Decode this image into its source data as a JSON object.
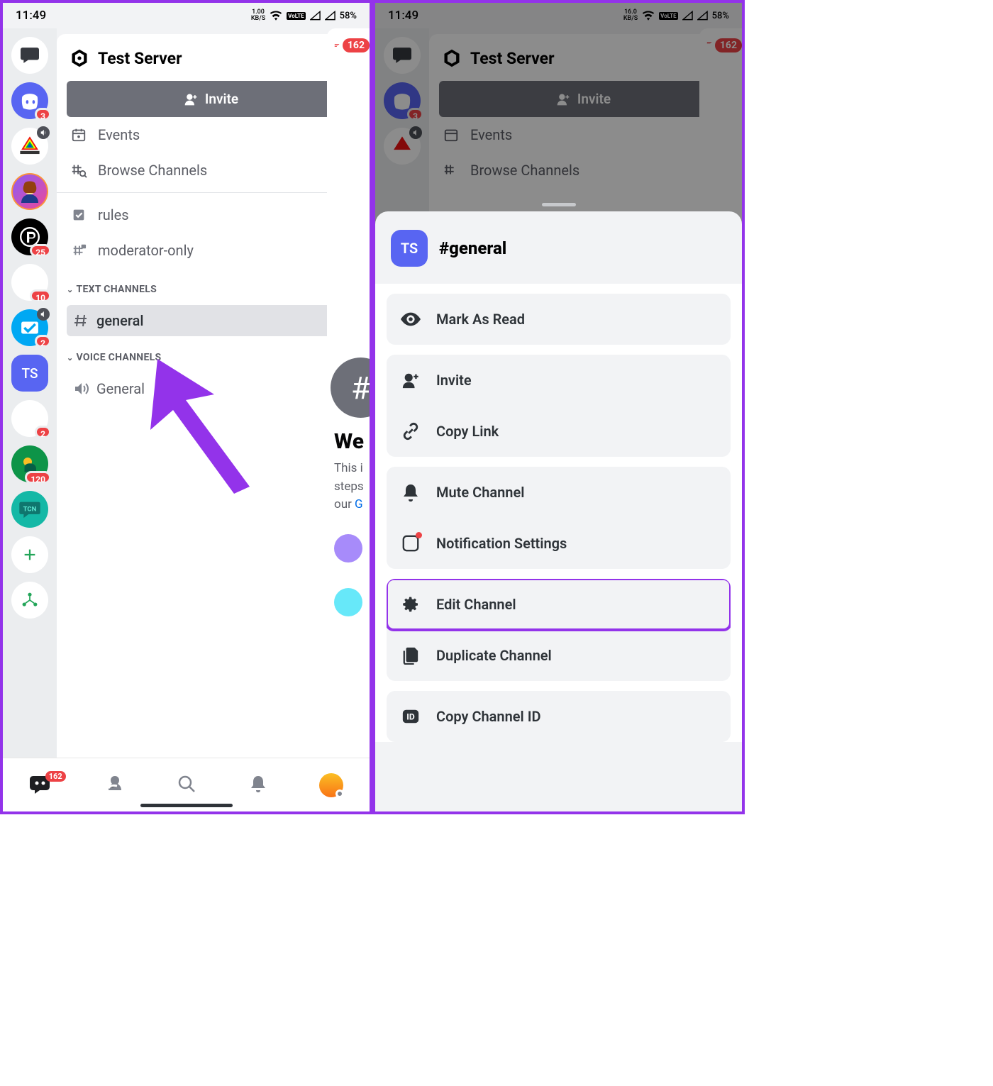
{
  "status": {
    "time": "11:49",
    "kbs_left": "1.00",
    "kbs_right": "16.0",
    "kbs_unit": "KB/S",
    "battery": "58%"
  },
  "server": {
    "title": "Test Server",
    "invite": "Invite",
    "events": "Events",
    "browse": "Browse Channels",
    "rules": "rules",
    "mod": "moderator-only",
    "cat_text": "TEXT CHANNELS",
    "cat_voice": "VOICE CHANNELS",
    "ch_general": "general",
    "vc_general": "General"
  },
  "rail": {
    "badges": {
      "wump": "3",
      "p": "25",
      "blank": "10",
      "tc": "2",
      "green": "120",
      "nav": "162"
    }
  },
  "peek": {
    "unread": "162",
    "welcome_prefix": "We",
    "sub1": "This i",
    "sub2": "steps",
    "sub3": "our",
    "sub3_link": "G"
  },
  "sheet": {
    "avatar": "TS",
    "name": "#general",
    "mark_read": "Mark As Read",
    "invite": "Invite",
    "copy_link": "Copy Link",
    "mute": "Mute Channel",
    "notif": "Notification Settings",
    "edit": "Edit Channel",
    "dup": "Duplicate Channel",
    "copy_id": "Copy Channel ID"
  }
}
